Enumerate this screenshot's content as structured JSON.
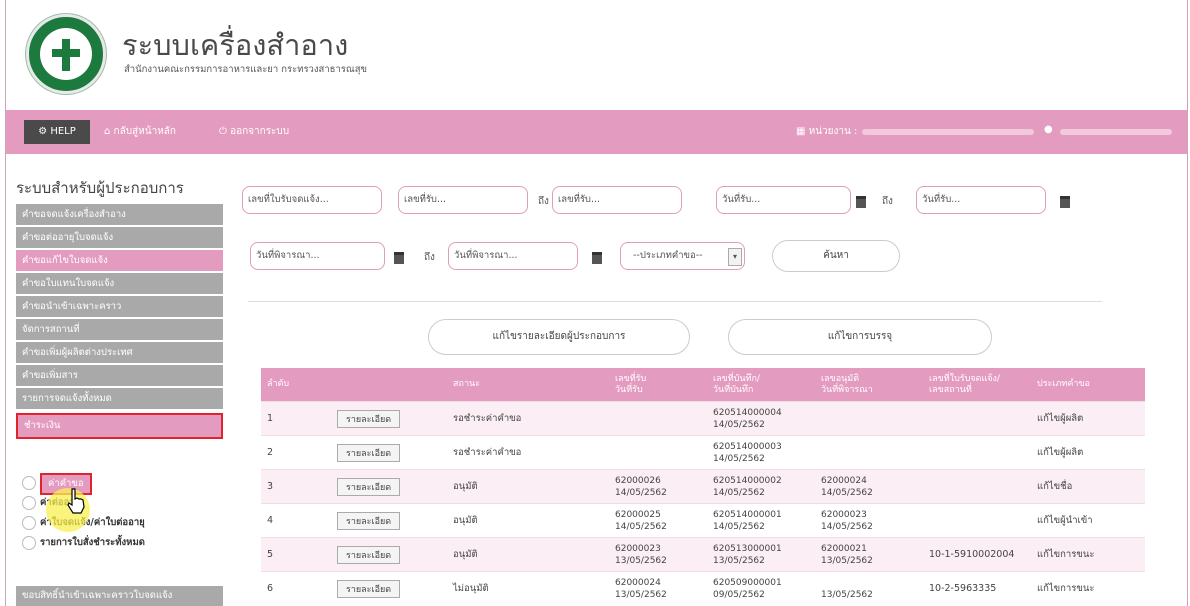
{
  "header": {
    "title": "ระบบเครื่องสำอาง",
    "subtitle": "สำนักงานคณะกรรมการอาหารและยา กระทรวงสาธารณสุข"
  },
  "nav": {
    "help": "HELP",
    "home": "กลับสู่หน้าหลัก",
    "logout": "ออกจากระบบ",
    "unit_label": "หน่วยงาน :"
  },
  "sidebar": {
    "title": "ระบบสำหรับผู้ประกอบการ",
    "items": [
      "คำขอจดแจ้งเครื่องสำอาง",
      "คำขอต่ออายุใบจดแจ้ง",
      "คำขอแก้ไขใบจดแจ้ง",
      "คำขอใบแทนใบจดแจ้ง",
      "คำขอนำเข้าเฉพาะคราว",
      "จัดการสถานที่",
      "คำขอเพิ่มผู้ผลิตต่างประเทศ",
      "คำขอเพิ่มสาร",
      "รายการจดแจ้งทั้งหมด"
    ],
    "pay": "ชำระเงิน",
    "sub_items": [
      "ค่าคำขอ",
      "ค่าต่ออายุ",
      "ค่าใบจดแจ้ง/ค่าใบต่ออายุ",
      "รายการใบสั่งชำระทั้งหมด"
    ],
    "bottom": "ขอบสิทธิ์นำเข้าเฉพาะคราวใบจดแจ้ง"
  },
  "filters": {
    "notify_no": "เลขที่ใบรับจดแจ้ง...",
    "recv_no_from": "เลขที่รับ...",
    "recv_no_to": "เลขที่รับ...",
    "recv_date_from": "วันที่รับ...",
    "recv_date_to": "วันที่รับ...",
    "review_date_from": "วันที่พิจารณา...",
    "review_date_to": "วันที่พิจารณา...",
    "to_label": "ถึง",
    "type_select": "--ประเภทคำขอ--",
    "search": "ค้นหา",
    "btn_edit_operator": "แก้ไขรายละเอียดผู้ประกอบการ",
    "btn_edit_packaging": "แก้ไขการบรรจุ"
  },
  "table": {
    "headers": [
      "ลำดับ",
      "",
      "สถานะ",
      "เลขที่รับ\nวันที่รับ",
      "เลขที่บันทึก/\nวันที่บันทึก",
      "เลขอนุมัติ\nวันที่พิจารณา",
      "เลขที่ใบรับจดแจ้ง/\nเลขสถานที่",
      "ประเภทคำขอ"
    ],
    "detail_label": "รายละเอียด",
    "rows": [
      {
        "no": "1",
        "status": "รอชำระค่าคำขอ",
        "recv": "",
        "recv_date": "",
        "rec": "620514000004",
        "rec_date": "14/05/2562",
        "appr": "",
        "appr_date": "",
        "notify": "",
        "type": "แก้ไขผู้ผลิต"
      },
      {
        "no": "2",
        "status": "รอชำระค่าคำขอ",
        "recv": "",
        "recv_date": "",
        "rec": "620514000003",
        "rec_date": "14/05/2562",
        "appr": "",
        "appr_date": "",
        "notify": "",
        "type": "แก้ไขผู้ผลิต"
      },
      {
        "no": "3",
        "status": "อนุมัติ",
        "recv": "62000026",
        "recv_date": "14/05/2562",
        "rec": "620514000002",
        "rec_date": "14/05/2562",
        "appr": "62000024",
        "appr_date": "14/05/2562",
        "notify": "",
        "type": "แก้ไขชื่อ"
      },
      {
        "no": "4",
        "status": "อนุมัติ",
        "recv": "62000025",
        "recv_date": "14/05/2562",
        "rec": "620514000001",
        "rec_date": "14/05/2562",
        "appr": "62000023",
        "appr_date": "14/05/2562",
        "notify": "",
        "type": "แก้ไขผู้นำเข้า"
      },
      {
        "no": "5",
        "status": "อนุมัติ",
        "recv": "62000023",
        "recv_date": "13/05/2562",
        "rec": "620513000001",
        "rec_date": "13/05/2562",
        "appr": "62000021",
        "appr_date": "13/05/2562",
        "notify": "10-1-5910002004",
        "type": "แก้ไขการขนะ"
      },
      {
        "no": "6",
        "status": "ไม่อนุมัติ",
        "recv": "62000024",
        "recv_date": "13/05/2562",
        "rec": "620509000001",
        "rec_date": "09/05/2562",
        "appr": "",
        "appr_date": "13/05/2562",
        "notify": "10-2-5963335",
        "type": "แก้ไขการขนะ"
      }
    ]
  },
  "colors": {
    "accent": "#e49bc0",
    "highlight": "#e0232c",
    "menu_gray": "#a9a9a9"
  }
}
